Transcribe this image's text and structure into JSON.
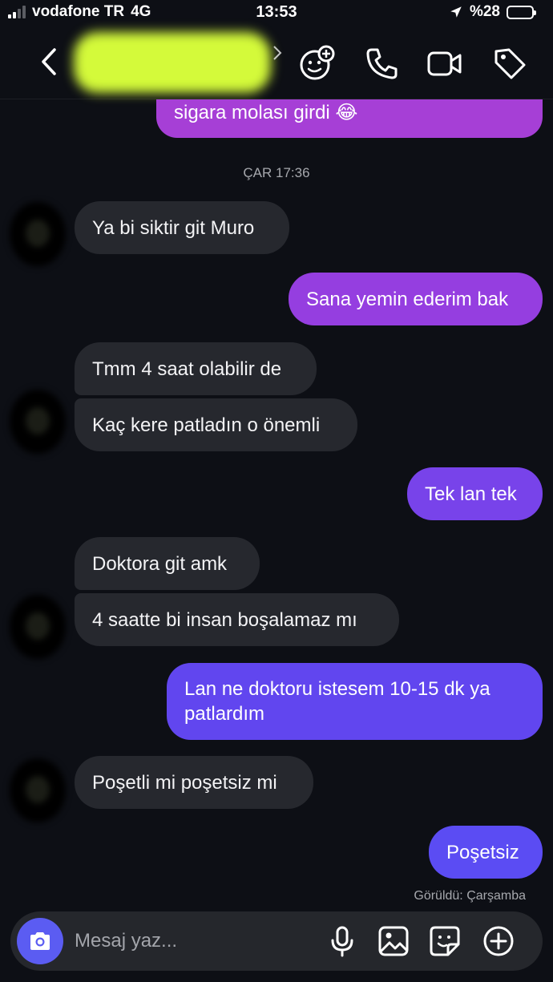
{
  "status": {
    "carrier": "vodafone TR",
    "network": "4G",
    "time": "13:53",
    "battery": "%28",
    "battery_level": 0.28
  },
  "header": {
    "back_icon": "chevron-left-icon",
    "actions": [
      "add-participant-icon",
      "phone-icon",
      "video-icon",
      "tag-icon"
    ]
  },
  "chat": {
    "prev_message": "sigara molası girdi 😂",
    "timestamp": "ÇAR 17:36",
    "messages": [
      {
        "side": "in",
        "text": "Ya bi siktir git Muro"
      },
      {
        "side": "out",
        "text": "Sana yemin ederim bak"
      },
      {
        "side": "in",
        "text": "Tmm 4 saat olabilir de"
      },
      {
        "side": "in",
        "text": "Kaç kere patladın o önemli"
      },
      {
        "side": "out",
        "text": "Tek lan tek"
      },
      {
        "side": "in",
        "text": "Doktora git amk"
      },
      {
        "side": "in",
        "text": "4 saatte bi insan boşalamaz mı"
      },
      {
        "side": "out",
        "line1": "Lan ne doktoru istesem 10-15 dk ya",
        "line2": "patlardım"
      },
      {
        "side": "in",
        "text": "Poşetli mi poşetsiz mi"
      },
      {
        "side": "out",
        "text": "Poşetsiz"
      }
    ],
    "seen": "Görüldü: Çarşamba"
  },
  "composer": {
    "placeholder": "Mesaj yaz...",
    "icons": [
      "camera-icon",
      "microphone-icon",
      "gallery-icon",
      "sticker-icon",
      "plus-icon"
    ]
  },
  "colors": {
    "in_bubble": "#26282e",
    "out_top": "#a63fd6",
    "out_bottom": "#5b4cf3",
    "camera": "#5b5cf2"
  }
}
